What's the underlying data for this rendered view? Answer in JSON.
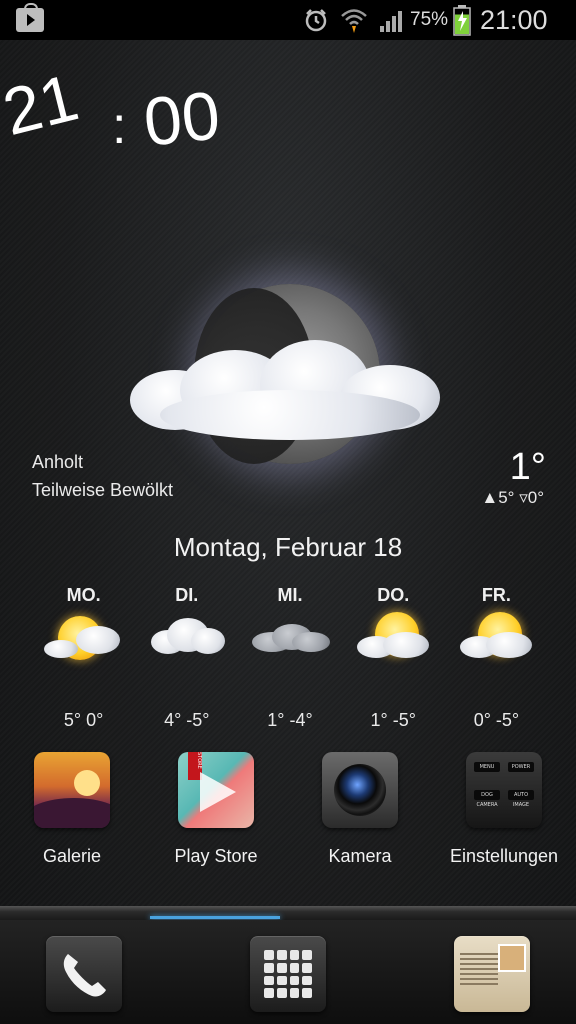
{
  "status_bar": {
    "notification_icon": "play-store-notification-icon",
    "alarm_icon": "alarm-icon",
    "wifi_icon": "wifi-icon",
    "signal_icon": "signal-icon",
    "battery_percent": "75%",
    "battery_level": 0.75,
    "battery_icon": "battery-charging-icon",
    "time": "21:00"
  },
  "clock": {
    "hours": "21",
    "separator": ":",
    "minutes": "00"
  },
  "weather": {
    "icon": "moon-cloud-icon",
    "location": "Anholt",
    "condition": "Teilweise Bewölkt",
    "temp_now": "1°",
    "hi_lo": "▲5° ▿0°",
    "date": "Montag, Februar 18"
  },
  "forecast": [
    {
      "day": "MO.",
      "temps": "5° 0°",
      "icon": "sun-cloud-icon"
    },
    {
      "day": "DI.",
      "temps": "4° -5°",
      "icon": "cloud-icon"
    },
    {
      "day": "MI.",
      "temps": "1° -4°",
      "icon": "overcast-cloud-icon"
    },
    {
      "day": "DO.",
      "temps": "1° -5°",
      "icon": "sun-cloud-icon"
    },
    {
      "day": "FR.",
      "temps": "0° -5°",
      "icon": "sun-cloud-icon"
    }
  ],
  "apps": [
    {
      "label": "Galerie",
      "icon": "gallery-icon"
    },
    {
      "label": "Play Store",
      "icon": "play-store-icon"
    },
    {
      "label": "Kamera",
      "icon": "camera-icon"
    },
    {
      "label": "Einstellungen",
      "icon": "settings-icon"
    }
  ],
  "settings_keys": [
    "MENU",
    "POWER",
    "DOG CAMERA",
    "AUTO IMAGE"
  ],
  "play_store_tag": "STORE",
  "dock": [
    {
      "name": "phone",
      "icon": "phone-icon"
    },
    {
      "name": "apps",
      "icon": "app-drawer-icon"
    },
    {
      "name": "messages",
      "icon": "messaging-icon"
    }
  ]
}
